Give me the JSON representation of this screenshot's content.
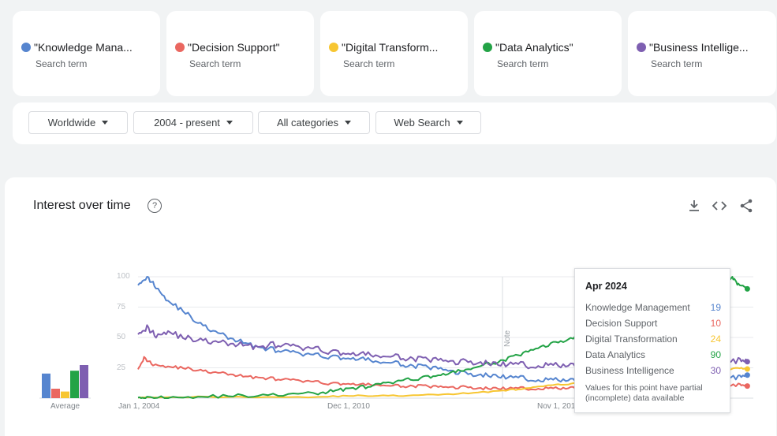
{
  "terms": [
    {
      "label": "\"Knowledge Mana...",
      "sub": "Search term",
      "color": "#5685cf"
    },
    {
      "label": "\"Decision Support\"",
      "sub": "Search term",
      "color": "#ea6760"
    },
    {
      "label": "\"Digital Transform...",
      "sub": "Search term",
      "color": "#f7c632"
    },
    {
      "label": "\"Data  Analytics\"",
      "sub": "Search term",
      "color": "#23a346"
    },
    {
      "label": "\"Business Intellige...",
      "sub": "Search term",
      "color": "#7e5fb1"
    }
  ],
  "filters": {
    "region": "Worldwide",
    "time": "2004 - present",
    "category": "All categories",
    "search_type": "Web Search"
  },
  "panel": {
    "title": "Interest over time",
    "help_icon": "help-circle-icon",
    "download_icon": "download-icon",
    "embed_icon": "embed-code-icon",
    "share_icon": "share-icon"
  },
  "chart_data": {
    "type": "line",
    "y_ticks": [
      "100",
      "75",
      "50",
      "25"
    ],
    "x_ticks": [
      "Jan 1, 2004",
      "Dec 1, 2010",
      "Nov 1, 201"
    ],
    "note_label": "Note",
    "ylim": [
      0,
      100
    ],
    "x_start": 2004.0,
    "x_end": 2024.5,
    "series": [
      {
        "color": "#5685cf",
        "points": [
          [
            2004.0,
            95
          ],
          [
            2004.3,
            100
          ],
          [
            2004.6,
            92
          ],
          [
            2005.0,
            80
          ],
          [
            2005.5,
            72
          ],
          [
            2006.0,
            62
          ],
          [
            2006.5,
            55
          ],
          [
            2007.0,
            50
          ],
          [
            2007.5,
            46
          ],
          [
            2008.0,
            42
          ],
          [
            2008.5,
            40
          ],
          [
            2009.0,
            38
          ],
          [
            2009.5,
            36
          ],
          [
            2010.0,
            35
          ],
          [
            2010.5,
            34
          ],
          [
            2011.0,
            33
          ],
          [
            2011.5,
            32
          ],
          [
            2012.0,
            30
          ],
          [
            2012.5,
            29
          ],
          [
            2013.0,
            27
          ],
          [
            2013.5,
            26
          ],
          [
            2014.0,
            24
          ],
          [
            2014.5,
            22
          ],
          [
            2015.0,
            20
          ],
          [
            2015.5,
            19
          ],
          [
            2016.0,
            18
          ],
          [
            2016.5,
            17
          ],
          [
            2017.0,
            16
          ],
          [
            2017.5,
            15
          ],
          [
            2018.0,
            15
          ],
          [
            2018.5,
            14
          ],
          [
            2019.0,
            14
          ],
          [
            2019.5,
            14
          ],
          [
            2020.0,
            13
          ],
          [
            2020.5,
            15
          ],
          [
            2021.0,
            14
          ],
          [
            2021.5,
            15
          ],
          [
            2022.0,
            16
          ],
          [
            2022.5,
            17
          ],
          [
            2023.0,
            17
          ],
          [
            2023.5,
            18
          ],
          [
            2024.0,
            17
          ],
          [
            2024.3,
            19
          ]
        ]
      },
      {
        "color": "#ea6760",
        "points": [
          [
            2004.0,
            25
          ],
          [
            2004.2,
            33
          ],
          [
            2004.5,
            28
          ],
          [
            2005.0,
            26
          ],
          [
            2005.5,
            25
          ],
          [
            2006.0,
            23
          ],
          [
            2006.5,
            21
          ],
          [
            2007.0,
            20
          ],
          [
            2007.5,
            18
          ],
          [
            2008.0,
            17
          ],
          [
            2008.5,
            16
          ],
          [
            2009.0,
            15
          ],
          [
            2009.5,
            14
          ],
          [
            2010.0,
            13
          ],
          [
            2010.5,
            12
          ],
          [
            2011.0,
            12
          ],
          [
            2011.5,
            11
          ],
          [
            2012.0,
            11
          ],
          [
            2012.5,
            10
          ],
          [
            2013.0,
            10
          ],
          [
            2013.5,
            10
          ],
          [
            2014.0,
            9
          ],
          [
            2014.5,
            9
          ],
          [
            2015.0,
            9
          ],
          [
            2015.5,
            8
          ],
          [
            2016.0,
            8
          ],
          [
            2016.5,
            8
          ],
          [
            2017.0,
            8
          ],
          [
            2017.5,
            8
          ],
          [
            2018.0,
            8
          ],
          [
            2018.5,
            8
          ],
          [
            2019.0,
            8
          ],
          [
            2019.5,
            9
          ],
          [
            2020.0,
            8
          ],
          [
            2020.5,
            9
          ],
          [
            2021.0,
            9
          ],
          [
            2021.5,
            9
          ],
          [
            2022.0,
            9
          ],
          [
            2022.5,
            10
          ],
          [
            2023.0,
            10
          ],
          [
            2023.5,
            10
          ],
          [
            2024.0,
            11
          ],
          [
            2024.3,
            10
          ]
        ]
      },
      {
        "color": "#f7c632",
        "points": [
          [
            2004.0,
            1
          ],
          [
            2006.0,
            1
          ],
          [
            2008.0,
            1
          ],
          [
            2010.0,
            1
          ],
          [
            2011.0,
            2
          ],
          [
            2012.0,
            2
          ],
          [
            2013.0,
            2
          ],
          [
            2014.0,
            3
          ],
          [
            2015.0,
            4
          ],
          [
            2016.0,
            6
          ],
          [
            2016.5,
            7
          ],
          [
            2017.0,
            8
          ],
          [
            2017.5,
            10
          ],
          [
            2018.0,
            11
          ],
          [
            2018.5,
            12
          ],
          [
            2019.0,
            13
          ],
          [
            2019.5,
            15
          ],
          [
            2020.0,
            16
          ],
          [
            2020.5,
            18
          ],
          [
            2021.0,
            19
          ],
          [
            2021.5,
            20
          ],
          [
            2022.0,
            21
          ],
          [
            2022.5,
            22
          ],
          [
            2023.0,
            22
          ],
          [
            2023.5,
            23
          ],
          [
            2024.0,
            25
          ],
          [
            2024.3,
            24
          ]
        ]
      },
      {
        "color": "#23a346",
        "points": [
          [
            2004.0,
            2
          ],
          [
            2004.3,
            0
          ],
          [
            2005.0,
            1
          ],
          [
            2006.0,
            1
          ],
          [
            2007.0,
            2
          ],
          [
            2008.0,
            2
          ],
          [
            2009.0,
            3
          ],
          [
            2010.0,
            4
          ],
          [
            2010.5,
            6
          ],
          [
            2011.0,
            8
          ],
          [
            2011.5,
            9
          ],
          [
            2012.0,
            11
          ],
          [
            2012.5,
            13
          ],
          [
            2013.0,
            15
          ],
          [
            2013.5,
            17
          ],
          [
            2014.0,
            19
          ],
          [
            2014.5,
            21
          ],
          [
            2015.0,
            24
          ],
          [
            2015.5,
            27
          ],
          [
            2016.0,
            30
          ],
          [
            2016.5,
            34
          ],
          [
            2017.0,
            38
          ],
          [
            2017.5,
            43
          ],
          [
            2018.0,
            46
          ],
          [
            2018.5,
            50
          ],
          [
            2019.0,
            52
          ],
          [
            2019.5,
            55
          ],
          [
            2020.0,
            58
          ],
          [
            2020.5,
            62
          ],
          [
            2021.0,
            66
          ],
          [
            2021.5,
            70
          ],
          [
            2022.0,
            74
          ],
          [
            2022.5,
            79
          ],
          [
            2023.0,
            84
          ],
          [
            2023.5,
            88
          ],
          [
            2023.8,
            100
          ],
          [
            2024.0,
            93
          ],
          [
            2024.3,
            90
          ]
        ]
      },
      {
        "color": "#7e5fb1",
        "points": [
          [
            2004.0,
            55
          ],
          [
            2004.3,
            58
          ],
          [
            2004.6,
            52
          ],
          [
            2005.0,
            55
          ],
          [
            2005.5,
            50
          ],
          [
            2006.0,
            48
          ],
          [
            2006.5,
            46
          ],
          [
            2007.0,
            45
          ],
          [
            2007.5,
            44
          ],
          [
            2008.0,
            42
          ],
          [
            2008.5,
            44
          ],
          [
            2009.0,
            43
          ],
          [
            2009.5,
            41
          ],
          [
            2010.0,
            40
          ],
          [
            2010.5,
            38
          ],
          [
            2011.0,
            37
          ],
          [
            2011.5,
            36
          ],
          [
            2012.0,
            35
          ],
          [
            2012.5,
            34
          ],
          [
            2013.0,
            33
          ],
          [
            2013.5,
            32
          ],
          [
            2014.0,
            31
          ],
          [
            2014.5,
            30
          ],
          [
            2015.0,
            30
          ],
          [
            2015.5,
            29
          ],
          [
            2016.0,
            28
          ],
          [
            2016.5,
            28
          ],
          [
            2017.0,
            27
          ],
          [
            2017.5,
            27
          ],
          [
            2018.0,
            27
          ],
          [
            2018.5,
            26
          ],
          [
            2019.0,
            26
          ],
          [
            2019.5,
            27
          ],
          [
            2020.0,
            26
          ],
          [
            2020.5,
            28
          ],
          [
            2021.0,
            29
          ],
          [
            2021.5,
            30
          ],
          [
            2022.0,
            30
          ],
          [
            2022.5,
            31
          ],
          [
            2023.0,
            31
          ],
          [
            2023.5,
            30
          ],
          [
            2024.0,
            31
          ],
          [
            2024.3,
            30
          ]
        ]
      }
    ],
    "averages": [
      26,
      10,
      7,
      29,
      35
    ],
    "average_label": "Average"
  },
  "tooltip": {
    "date": "Apr 2024",
    "rows": [
      {
        "label": "Knowledge Management",
        "value": "19",
        "color": "#5685cf"
      },
      {
        "label": "Decision Support",
        "value": "10",
        "color": "#ea6760"
      },
      {
        "label": "Digital Transformation",
        "value": "24",
        "color": "#f7c632"
      },
      {
        "label": "Data Analytics",
        "value": "90",
        "color": "#23a346"
      },
      {
        "label": "Business Intelligence",
        "value": "30",
        "color": "#7e5fb1"
      }
    ],
    "note": "Values for this point have partial (incomplete) data available"
  }
}
